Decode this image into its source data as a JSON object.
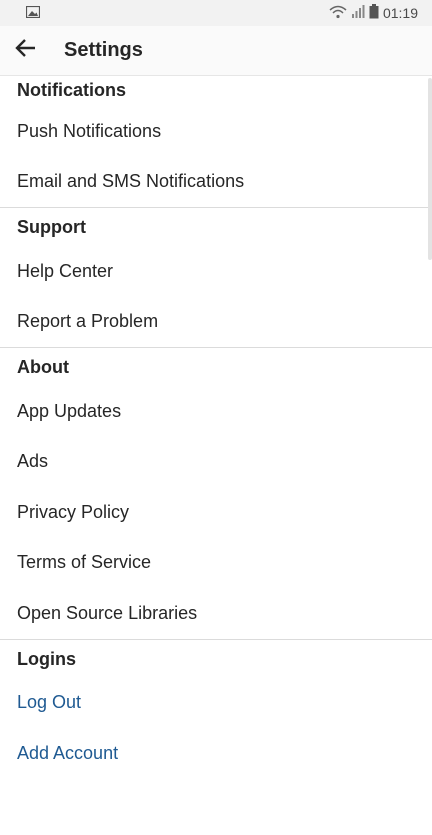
{
  "status_bar": {
    "time": "01:19",
    "left_icon": "gallery-icon",
    "wifi_icon": "wifi-icon",
    "signal_icon": "signal-icon",
    "battery_icon": "battery-icon"
  },
  "app_bar": {
    "back_icon": "back-arrow-icon",
    "title": "Settings"
  },
  "sections": [
    {
      "header": "Notifications",
      "items": [
        "Push Notifications",
        "Email and SMS Notifications"
      ]
    },
    {
      "header": "Support",
      "items": [
        "Help Center",
        "Report a Problem"
      ]
    },
    {
      "header": "About",
      "items": [
        "App Updates",
        "Ads",
        "Privacy Policy",
        "Terms of Service",
        "Open Source Libraries"
      ]
    },
    {
      "header": "Logins",
      "items": [
        "Log Out",
        "Add Account"
      ]
    }
  ],
  "colors": {
    "link": "#1f5a92",
    "text": "#262626",
    "divider": "#dbdbdb"
  }
}
